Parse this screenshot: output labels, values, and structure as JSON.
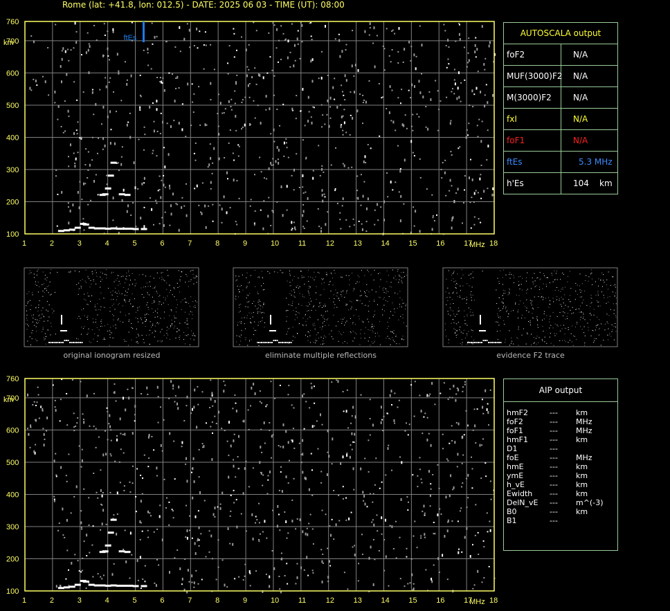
{
  "header": "Rome (lat: +41.8, lon: 012.5) - DATE: 2025 06 03 - TIME (UT): 08:00",
  "colors": {
    "axis": "#ffff66",
    "grid": "#808080",
    "ftes": "#1e7be6",
    "fof1": "#ff2020",
    "fxl": "#ffff33",
    "table_border": "#9acd9a"
  },
  "autoscala": {
    "title": "AUTOSCALA output",
    "rows": [
      {
        "key": "foF2",
        "value": "N/A",
        "unit": "",
        "color": "#ffffff"
      },
      {
        "key": "MUF(3000)F2",
        "value": "N/A",
        "unit": "",
        "color": "#ffffff"
      },
      {
        "key": "M(3000)F2",
        "value": "N/A",
        "unit": "",
        "color": "#ffffff"
      },
      {
        "key": "fxI",
        "value": "N/A",
        "unit": "",
        "color": "#ffff33"
      },
      {
        "key": "foF1",
        "value": "N/A",
        "unit": "",
        "color": "#ff2020"
      },
      {
        "key": "ftEs",
        "value": "5.3 MHz",
        "unit": "",
        "color": "#3c8cff"
      },
      {
        "key": "h'Es",
        "value": "104",
        "unit": "km",
        "color": "#ffffff"
      }
    ]
  },
  "aip": {
    "title": "AIP output",
    "rows": [
      {
        "key": "hmF2",
        "value": "---",
        "unit": "km"
      },
      {
        "key": "foF2",
        "value": "---",
        "unit": "MHz"
      },
      {
        "key": "foF1",
        "value": "---",
        "unit": "MHz"
      },
      {
        "key": "hmF1",
        "value": "---",
        "unit": "km"
      },
      {
        "key": "D1",
        "value": "---",
        "unit": ""
      },
      {
        "key": "foE",
        "value": "---",
        "unit": "MHz"
      },
      {
        "key": "hmE",
        "value": "---",
        "unit": "km"
      },
      {
        "key": "ymE",
        "value": "---",
        "unit": "km"
      },
      {
        "key": "h_vE",
        "value": "---",
        "unit": "km"
      },
      {
        "key": "Ewidth",
        "value": "---",
        "unit": "km"
      },
      {
        "key": "DelN_vE",
        "value": "---",
        "unit": "m^(-3)"
      },
      {
        "key": "B0",
        "value": "---",
        "unit": "km"
      },
      {
        "key": "B1",
        "value": "---",
        "unit": ""
      }
    ]
  },
  "captions": [
    "original ionogram resized",
    "eliminate multiple reflections",
    "evidence F2 trace"
  ],
  "chart_data": [
    {
      "type": "scatter",
      "title": "",
      "xlabel": "MHz",
      "ylabel": "km",
      "xlim": [
        1,
        18
      ],
      "ylim": [
        100,
        760
      ],
      "x_ticks": [
        1,
        2,
        3,
        4,
        5,
        6,
        7,
        8,
        9,
        10,
        11,
        12,
        13,
        14,
        15,
        16,
        17,
        18
      ],
      "y_ticks": [
        100,
        200,
        300,
        400,
        500,
        600,
        700,
        760
      ],
      "grid": true,
      "marker": {
        "label": "ftEs",
        "x": 5.3
      },
      "series": [
        {
          "trace": "Es",
          "x": [
            2.3,
            2.5,
            2.7,
            2.9,
            3.1,
            3.2,
            3.4,
            3.6,
            3.8,
            4.0,
            4.2,
            4.4,
            4.6,
            4.8,
            5.0,
            5.3
          ],
          "y": [
            108,
            110,
            112,
            118,
            130,
            128,
            118,
            116,
            116,
            115,
            116,
            115,
            115,
            115,
            114,
            114
          ]
        },
        {
          "trace": "Es-2nd",
          "x": [
            3.8,
            3.9,
            4.0,
            4.1,
            4.2,
            4.5,
            4.7
          ],
          "y": [
            220,
            222,
            240,
            280,
            320,
            222,
            220
          ]
        }
      ]
    },
    {
      "type": "scatter",
      "title": "",
      "xlabel": "MHz",
      "ylabel": "km",
      "xlim": [
        1,
        18
      ],
      "ylim": [
        100,
        760
      ],
      "x_ticks": [
        1,
        2,
        3,
        4,
        5,
        6,
        7,
        8,
        9,
        10,
        11,
        12,
        13,
        14,
        15,
        16,
        17,
        18
      ],
      "y_ticks": [
        100,
        200,
        300,
        400,
        500,
        600,
        700,
        760
      ],
      "grid": true,
      "series": [
        {
          "trace": "Es",
          "x": [
            2.3,
            2.5,
            2.7,
            2.9,
            3.1,
            3.2,
            3.4,
            3.6,
            3.8,
            4.0,
            4.2,
            4.4,
            4.6,
            4.8,
            5.0,
            5.3
          ],
          "y": [
            108,
            110,
            112,
            118,
            130,
            128,
            118,
            116,
            116,
            115,
            116,
            115,
            115,
            115,
            114,
            114
          ]
        },
        {
          "trace": "Es-2nd",
          "x": [
            3.8,
            3.9,
            4.0,
            4.1,
            4.2,
            4.5,
            4.7
          ],
          "y": [
            220,
            222,
            240,
            280,
            320,
            222,
            220
          ]
        }
      ]
    }
  ]
}
